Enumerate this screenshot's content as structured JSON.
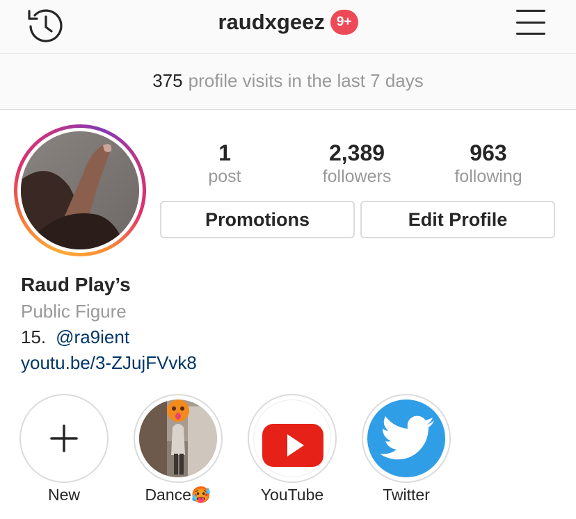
{
  "header": {
    "username": "raudxgeez",
    "notification_badge": "9+",
    "history_icon": "history-clock-icon",
    "menu_icon": "hamburger-menu-icon"
  },
  "insights": {
    "visit_count": "375",
    "visit_text": "profile visits in the last 7 days"
  },
  "profile": {
    "stats": [
      {
        "value": "1",
        "label": "post"
      },
      {
        "value": "2,389",
        "label": "followers"
      },
      {
        "value": "963",
        "label": "following"
      }
    ],
    "buttons": {
      "promotions": "Promotions",
      "edit_profile": "Edit Profile"
    }
  },
  "bio": {
    "name": "Raud Play’s",
    "category": "Public Figure",
    "age": "15.",
    "mention": "@ra9ient",
    "link": "youtu.be/3-ZJujFVvk8"
  },
  "highlights": [
    {
      "label": "New",
      "icon": "plus-icon"
    },
    {
      "label": "Dance🥵",
      "icon": "dance-photo"
    },
    {
      "label": "YouTube",
      "icon": "youtube-icon"
    },
    {
      "label": "Twitter",
      "icon": "twitter-bird-icon"
    }
  ],
  "colors": {
    "badge_red": "#ed4956",
    "link_blue": "#003569",
    "muted_gray": "#999999",
    "border_gray": "#dbdbdb",
    "youtube_red": "#e62117",
    "twitter_blue": "#2f9ee7"
  }
}
